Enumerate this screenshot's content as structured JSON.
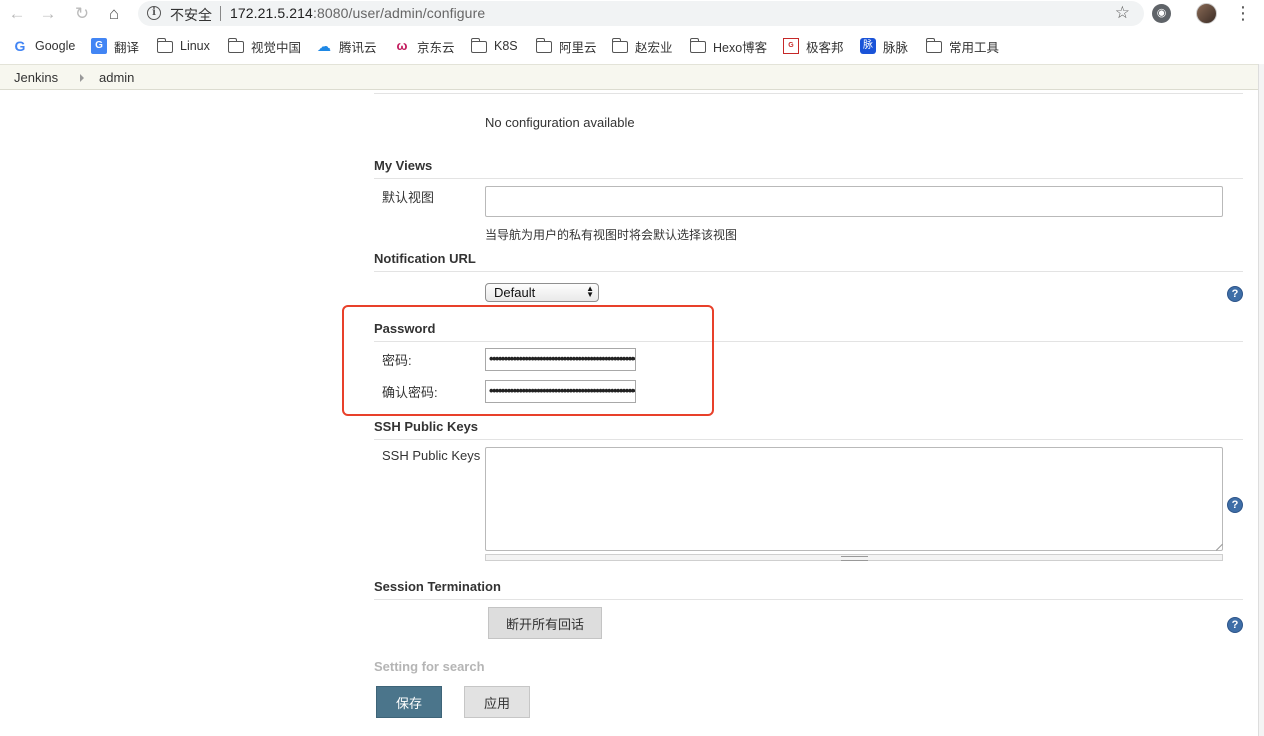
{
  "browser": {
    "url_insecure_label": "不安全",
    "url_host": "172.21.5.214",
    "url_path": ":8080/user/admin/configure",
    "icons": {
      "back": "arrow-left-icon",
      "forward": "arrow-right-icon",
      "reload": "reload-icon",
      "home": "home-icon",
      "info": "info-icon",
      "bookmark_star": "star-icon",
      "menu": "kebab-menu-icon"
    }
  },
  "bookmarks": [
    {
      "label": "Google",
      "icon": "google-icon"
    },
    {
      "label": "翻译",
      "icon": "translate-icon"
    },
    {
      "label": "Linux",
      "icon": "folder-icon"
    },
    {
      "label": "视觉中国",
      "icon": "folder-icon"
    },
    {
      "label": "腾讯云",
      "icon": "cloud-icon"
    },
    {
      "label": "京东云",
      "icon": "jdcloud-icon"
    },
    {
      "label": "K8S",
      "icon": "folder-icon"
    },
    {
      "label": "阿里云",
      "icon": "folder-icon"
    },
    {
      "label": "赵宏业",
      "icon": "folder-icon"
    },
    {
      "label": "Hexo博客",
      "icon": "folder-icon"
    },
    {
      "label": "极客邦",
      "icon": "geekbang-icon"
    },
    {
      "label": "脉脉",
      "icon": "maimai-icon"
    },
    {
      "label": "常用工具",
      "icon": "folder-icon"
    }
  ],
  "breadcrumb": {
    "root": "Jenkins",
    "current": "admin"
  },
  "form": {
    "no_config": "No configuration available",
    "my_views": {
      "title": "My Views",
      "label": "默认视图",
      "value": "",
      "hint": "当导航为用户的私有视图时将会默认选择该视图"
    },
    "notification": {
      "title": "Notification URL",
      "selected": "Default"
    },
    "password": {
      "title": "Password",
      "label": "密码:",
      "confirm_label": "确认密码:",
      "masked_value": "••••••••••••••••••••••••••••••••••••••••••••••••••••••••••••••••••",
      "masked_confirm": "••••••••••••••••••••••••••••••••••••••••••••••••••••••••••••••••••"
    },
    "ssh": {
      "title": "SSH Public Keys",
      "label": "SSH Public Keys",
      "value": ""
    },
    "session": {
      "title": "Session Termination",
      "button": "断开所有回话"
    },
    "search_title": "Setting for search",
    "save_button": "保存",
    "apply_button": "应用"
  },
  "colors": {
    "highlight": "#e8402a",
    "save_button": "#4b758b",
    "help_icon": "#3e6ea7"
  }
}
